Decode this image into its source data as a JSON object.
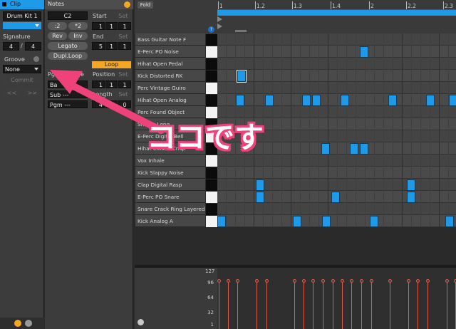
{
  "clip_panel": {
    "title": "Clip",
    "name": "Drum Kit 1",
    "signature_label": "Signature",
    "sig_num": "4",
    "sig_sep": "/",
    "sig_den": "4",
    "groove_label": "Groove",
    "groove_value": "None",
    "commit_label": "Commit",
    "prev_label": "<<",
    "next_label": ">>"
  },
  "notes_panel": {
    "title": "Notes",
    "root_note": "C2",
    "start_label": "Start",
    "set_label": "Set",
    "start": [
      "1",
      "1",
      "1"
    ],
    "half_label": ":2",
    "double_label": "*2",
    "rev_label": "Rev",
    "inv_label": "Inv",
    "end_label": "End",
    "end": [
      "5",
      "1",
      "1"
    ],
    "legato_label": "Legato",
    "dupl_label": "Dupl.Loop",
    "loop_label": "Loop",
    "position_label": "Position",
    "position": [
      "1",
      "1",
      "1"
    ],
    "pgm_change_label": "Pgm Change",
    "bank_label": "Ba",
    "sub_label": "Sub ---",
    "pgm_label": "Pgm ---",
    "length_label": "Length",
    "length": [
      "4",
      "0",
      "0"
    ]
  },
  "editor": {
    "fold_label": "Fold",
    "help_label": "?",
    "ruler": [
      "1",
      "1.2",
      "1.3",
      "1.4",
      "2",
      "2.2",
      "2.3"
    ],
    "rows": [
      "Bass Guitar Note F",
      "E-Perc PO Noise",
      "Hihat Open Pedal",
      "Kick Distorted RK",
      "Perc Vintage Guiro",
      "Hihat Open Analog",
      "Perc Found Object",
      "Shaker Long",
      "E-Perc Digital Bell",
      "Hihat Closed Crisp",
      "Vox Inhale",
      "Kick Slappy Noise",
      "Clap Digital Rasp",
      "E-Perc PO Snare",
      "Snare Crack Ring Layered",
      "Kick Analog A"
    ]
  },
  "velocity": {
    "labels": [
      "127",
      "96",
      "64",
      "32",
      "1"
    ]
  },
  "annotation": {
    "text": "ココです",
    "color": "#f0427a"
  },
  "colors": {
    "accent": "#1e9ae8",
    "velocity": "#e05a4b",
    "loop": "#f5a623"
  }
}
